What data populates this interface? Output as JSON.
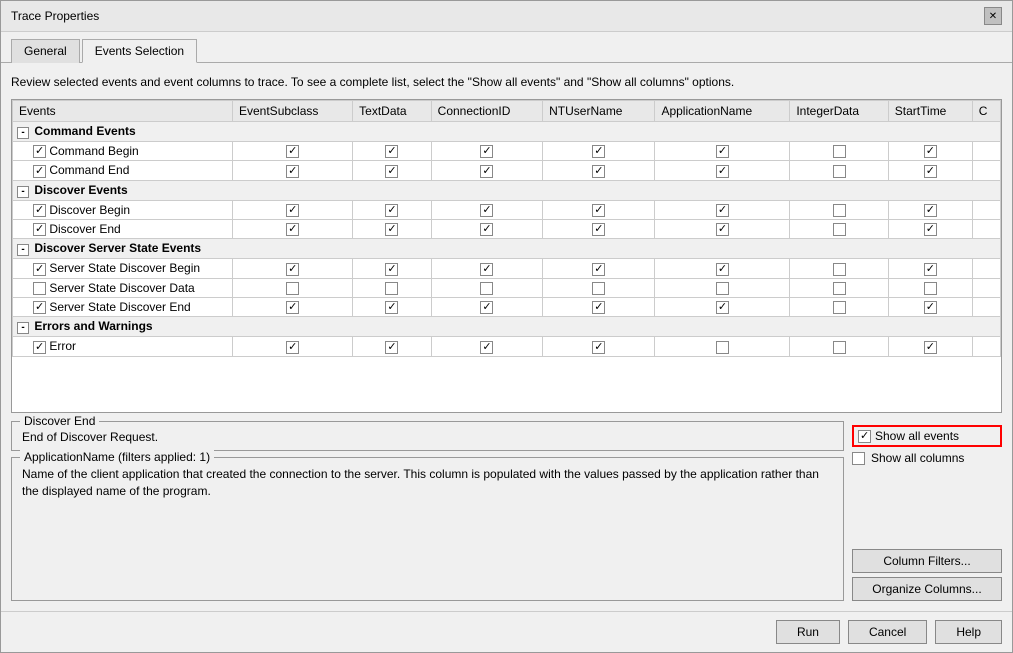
{
  "dialog": {
    "title": "Trace Properties",
    "close_label": "✕"
  },
  "tabs": [
    {
      "id": "general",
      "label": "General",
      "active": false
    },
    {
      "id": "events-selection",
      "label": "Events Selection",
      "active": true
    }
  ],
  "instruction": "Review selected events and event columns to trace. To see a complete list, select the \"Show all events\" and \"Show all columns\" options.",
  "table": {
    "columns": [
      "Events",
      "EventSubclass",
      "TextData",
      "ConnectionID",
      "NTUserName",
      "ApplicationName",
      "IntegerData",
      "StartTime",
      "C"
    ],
    "groups": [
      {
        "name": "Command Events",
        "rows": [
          {
            "name": "Command Begin",
            "checks": [
              true,
              true,
              true,
              true,
              true,
              false,
              true
            ]
          },
          {
            "name": "Command End",
            "checks": [
              true,
              true,
              true,
              true,
              true,
              false,
              true
            ]
          }
        ]
      },
      {
        "name": "Discover Events",
        "rows": [
          {
            "name": "Discover Begin",
            "checks": [
              true,
              true,
              true,
              true,
              true,
              false,
              true
            ]
          },
          {
            "name": "Discover End",
            "checks": [
              true,
              true,
              true,
              true,
              true,
              false,
              true
            ]
          }
        ]
      },
      {
        "name": "Discover Server State Events",
        "rows": [
          {
            "name": "Server State Discover Begin",
            "checks": [
              true,
              true,
              true,
              true,
              true,
              false,
              true
            ]
          },
          {
            "name": "Server State Discover Data",
            "checks": [
              false,
              false,
              false,
              false,
              false,
              false,
              false
            ]
          },
          {
            "name": "Server State Discover End",
            "checks": [
              true,
              true,
              true,
              true,
              true,
              false,
              true
            ]
          }
        ]
      },
      {
        "name": "Errors and Warnings",
        "rows": [
          {
            "name": "Error",
            "checks": [
              true,
              true,
              true,
              true,
              false,
              false,
              true
            ]
          }
        ]
      }
    ]
  },
  "discover_end": {
    "legend": "Discover End",
    "text": "End of Discover Request."
  },
  "app_name": {
    "legend": "ApplicationName (filters applied: 1)",
    "text": "Name of the client application that created the connection to the server. This column is populated with the values passed by the application rather than the displayed name of the program."
  },
  "show_options": {
    "show_all_events_label": "Show all events",
    "show_all_columns_label": "Show all columns",
    "show_all_events_checked": true,
    "show_all_columns_checked": false
  },
  "action_buttons": {
    "column_filters": "Column Filters...",
    "organize_columns": "Organize Columns..."
  },
  "footer_buttons": {
    "run": "Run",
    "cancel": "Cancel",
    "help": "Help"
  }
}
